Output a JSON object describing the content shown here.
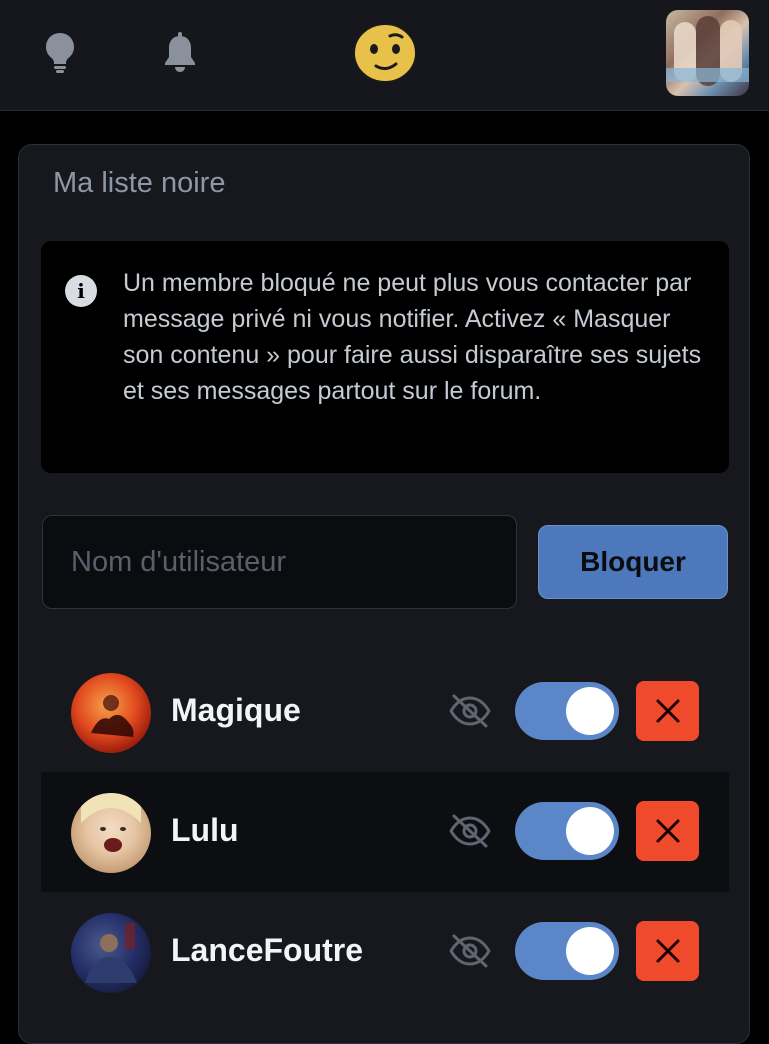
{
  "header": {
    "nav_icons": [
      "lightbulb-icon",
      "bell-icon",
      "emoji-avatar-icon"
    ],
    "profile_avatar": "profile-avatar"
  },
  "blacklist": {
    "title": "Ma liste noire",
    "info_icon": "info-icon",
    "info_text": "Un membre bloqué ne peut plus vous contacter par message privé ni vous notifier. Activez « Masquer son contenu » pour faire aussi disparaître ses sujets et ses messages partout sur le forum.",
    "input_placeholder": "Nom d'utilisateur",
    "input_value": "",
    "block_button_label": "Bloquer",
    "users": [
      {
        "name": "Magique",
        "hide_content": true,
        "avatar_color": "#d93a1e"
      },
      {
        "name": "Lulu",
        "hide_content": true,
        "avatar_color": "#e8d4b8"
      },
      {
        "name": "LanceFoutre",
        "hide_content": true,
        "avatar_color": "#1f2a55"
      }
    ]
  },
  "colors": {
    "accent": "#5b86c8",
    "button": "#4d79bc",
    "danger": "#f04a2c",
    "emoji": "#e8c14a"
  }
}
